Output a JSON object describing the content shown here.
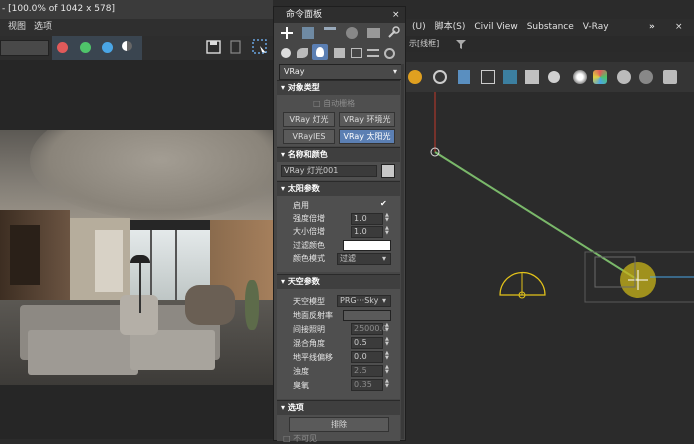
{
  "frame_window": {
    "title": "- [100.0% of 1042 x 578]",
    "menu": [
      "视图",
      "选项"
    ]
  },
  "main_menu": [
    "(U)",
    "脚本(S)",
    "Civil View",
    "Substance",
    "V-Ray"
  ],
  "main_menu_more": "»",
  "main_menu_close": "×",
  "viewport_header": "示[线框]",
  "viewport_filter_icon": "funnel-icon",
  "command_panel": {
    "title": "命令面板",
    "close": "×",
    "category_dropdown": "VRay",
    "sections": {
      "object_type": {
        "title": "对象类型",
        "autogrid": "自动栅格",
        "buttons": [
          "VRay 灯光",
          "VRay 环境光",
          "VRayIES",
          "VRay 太阳光"
        ]
      },
      "name_color": {
        "title": "名称和颜色",
        "name": "VRay 灯光001",
        "swatch_color": "#c8c8c8"
      },
      "sun_params": {
        "title": "太阳参数",
        "enabled_label": "启用",
        "intensity_label": "强度倍增",
        "intensity_value": "1.0",
        "size_label": "大小倍增",
        "size_value": "1.0",
        "filter_color_label": "过滤颜色",
        "filter_color": "#ffffff",
        "color_mode_label": "颜色模式",
        "color_mode_value": "过滤"
      },
      "sky_params": {
        "title": "天空参数",
        "sky_model_label": "天空模型",
        "sky_model_value": "PRG···Sky",
        "ground_albedo_label": "地面反射率",
        "indirect_label": "间接照明",
        "indirect_value": "25000.0",
        "blend_angle_label": "混合角度",
        "blend_angle_value": "0.5",
        "horizon_offset_label": "地平线偏移",
        "horizon_offset_value": "0.0",
        "turbidity_label": "浊度",
        "turbidity_value": "2.5",
        "ozone_label": "臭氧",
        "ozone_value": "0.35"
      },
      "options": {
        "title": "选项",
        "exclude_label": "排除",
        "invisible_label": "不可见"
      }
    }
  },
  "colors": {
    "active_button": "#5b7fb3",
    "sun_line": "#7ab86a",
    "gizmo_yellow": "#e2c21a",
    "red_axis": "#c0392b"
  }
}
